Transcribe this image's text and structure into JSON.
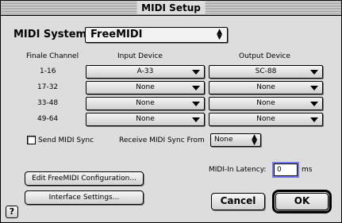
{
  "window": {
    "title": "MIDI Setup"
  },
  "midi_system": {
    "label": "MIDI System",
    "value": "FreeMIDI"
  },
  "headers": {
    "channel": "Finale Channel",
    "input": "Input Device",
    "output": "Output Device"
  },
  "rows": [
    {
      "channel": "1-16",
      "input": "A-33",
      "output": "SC-88"
    },
    {
      "channel": "17-32",
      "input": "None",
      "output": "None"
    },
    {
      "channel": "33-48",
      "input": "None",
      "output": "None"
    },
    {
      "channel": "49-64",
      "input": "None",
      "output": "None"
    }
  ],
  "sync": {
    "send_label": "Send MIDI Sync",
    "receive_label": "Receive MIDI Sync From",
    "receive_value": "None"
  },
  "latency": {
    "label": "MIDI-In Latency:",
    "value": "0",
    "unit": "ms"
  },
  "buttons": {
    "edit_config": "Edit FreeMIDI Configuration...",
    "interface": "Interface Settings...",
    "cancel": "Cancel",
    "ok": "OK",
    "help": "?"
  }
}
